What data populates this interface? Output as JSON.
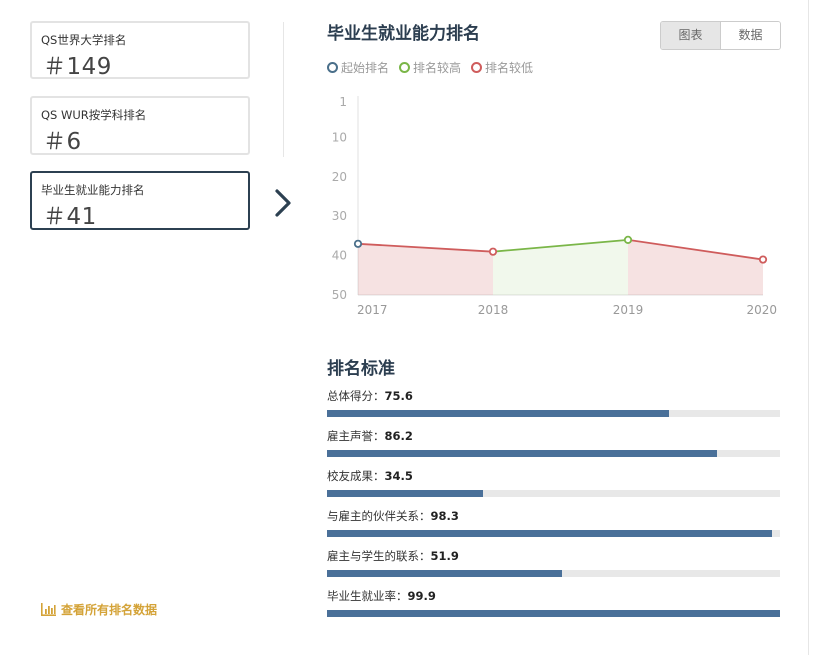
{
  "cards": [
    {
      "label": "QS世界大学排名",
      "value": "＃149",
      "active": false
    },
    {
      "label": "QS WUR按学科排名",
      "value": "＃6",
      "active": false
    },
    {
      "label": "毕业生就业能力排名",
      "value": "＃41",
      "active": true
    }
  ],
  "view_all_label": "查看所有排名数据",
  "section_title": "毕业生就业能力排名",
  "toggle": {
    "chart_label": "图表",
    "data_label": "数据"
  },
  "legend": [
    {
      "label": "起始排名",
      "color": "#4a6f8a"
    },
    {
      "label": "排名较高",
      "color": "#7ab648"
    },
    {
      "label": "排名较低",
      "color": "#cf5c5c"
    }
  ],
  "chart_data": {
    "type": "line",
    "x": [
      "2017",
      "2018",
      "2019",
      "2020"
    ],
    "values": [
      37,
      39,
      36,
      41
    ],
    "y_ticks": [
      "1",
      "10",
      "20",
      "30",
      "40",
      "50"
    ],
    "ylim": [
      1,
      50
    ],
    "y_inverted": true,
    "point_status": [
      "起始排名",
      "排名较低",
      "排名较高",
      "排名较低"
    ]
  },
  "criteria_title": "排名标准",
  "criteria": [
    {
      "label": "总体得分：",
      "value": "75.6",
      "score": 75.6
    },
    {
      "label": "雇主声誉：",
      "value": "86.2",
      "score": 86.2
    },
    {
      "label": "校友成果：",
      "value": "34.5",
      "score": 34.5
    },
    {
      "label": "与雇主的伙伴关系：",
      "value": "98.3",
      "score": 98.3
    },
    {
      "label": "雇主与学生的联系：",
      "value": "51.9",
      "score": 51.9
    },
    {
      "label": "毕业生就业率：",
      "value": "99.9",
      "score": 99.9
    }
  ],
  "colors": {
    "bar": "#4a7099",
    "accent": "#d4a338",
    "dark": "#2c4051"
  }
}
